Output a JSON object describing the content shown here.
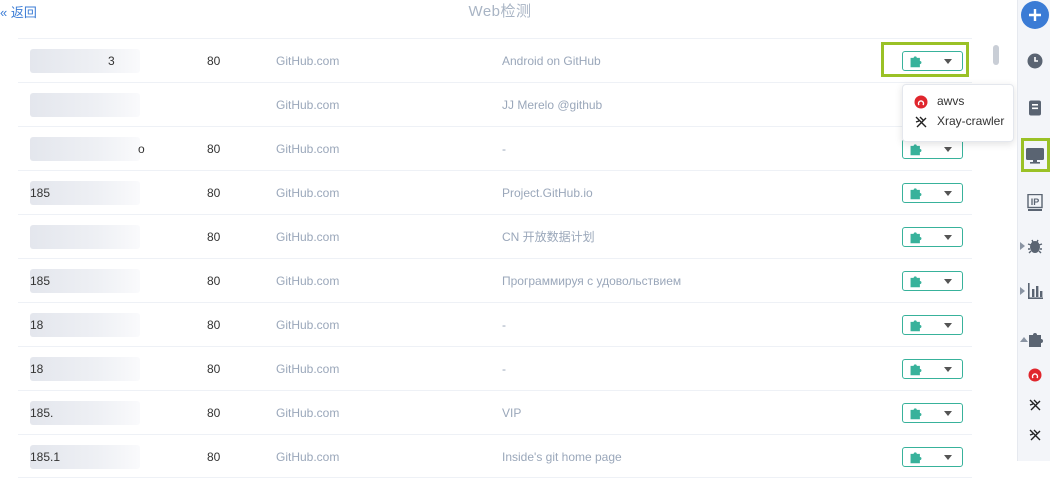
{
  "header": {
    "back_label": "« 返回",
    "title": "Web检测"
  },
  "rows": [
    {
      "host": "             3",
      "port": "80",
      "domain": "GitHub.com",
      "title": "Android on GitHub"
    },
    {
      "host": "",
      "port": "",
      "domain": "GitHub.com",
      "title": "JJ Merelo @github"
    },
    {
      "host": "                  o",
      "port": "80",
      "domain": "GitHub.com",
      "title": "-"
    },
    {
      "host": "185",
      "port": "80",
      "domain": "GitHub.com",
      "title": "Project.GitHub.io"
    },
    {
      "host": "",
      "port": "80",
      "domain": "GitHub.com",
      "title": "CN 开放数据计划"
    },
    {
      "host": "185",
      "port": "80",
      "domain": "GitHub.com",
      "title": "Программируя с удовольствием"
    },
    {
      "host": "18",
      "port": "80",
      "domain": "GitHub.com",
      "title": "-"
    },
    {
      "host": "18",
      "port": "80",
      "domain": "GitHub.com",
      "title": "-"
    },
    {
      "host": "185.",
      "port": "80",
      "domain": "GitHub.com",
      "title": "VIP"
    },
    {
      "host": "185.1",
      "port": "80",
      "domain": "GitHub.com",
      "title": "Inside's git home page"
    }
  ],
  "dropdown": {
    "items": [
      "awvs",
      "Xray-crawler"
    ]
  },
  "colors": {
    "accent": "#3a7bd5",
    "plugin": "#38b29b",
    "highlight": "#9ac126",
    "muted": "#9aa7ba"
  },
  "sidebar": {
    "icons": [
      "plus-icon",
      "clock-icon",
      "report-icon",
      "monitor-icon",
      "ip-icon",
      "bug-icon",
      "chart-icon",
      "puzzle-icon",
      "awvs-icon",
      "xray-icon",
      "xray-icon"
    ]
  }
}
